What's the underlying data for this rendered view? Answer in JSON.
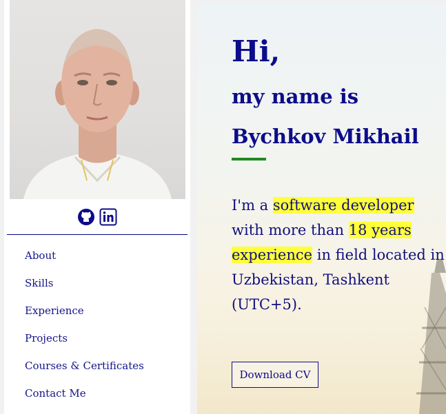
{
  "sidebar": {
    "nav": [
      {
        "label": "About"
      },
      {
        "label": "Skills"
      },
      {
        "label": "Experience"
      },
      {
        "label": "Projects"
      },
      {
        "label": "Courses & Certificates"
      },
      {
        "label": "Contact Me"
      }
    ],
    "social_icons": [
      "github-icon",
      "linkedin-icon"
    ]
  },
  "hero": {
    "greeting": "Hi,",
    "intro": "my name is",
    "name": "Bychkov Mikhail",
    "bio": {
      "prefix": "I'm a",
      "role": "software developer",
      "middle": "with more than",
      "years": "18 years",
      "experience": "experience",
      "suffix": "in field located in Uzbekistan, Tashkent (UTC+5)."
    },
    "button": "Download CV"
  },
  "colors": {
    "primary": "#0c0c8a",
    "accent_green": "#1f8a1f",
    "highlight": "#ffff3a"
  }
}
